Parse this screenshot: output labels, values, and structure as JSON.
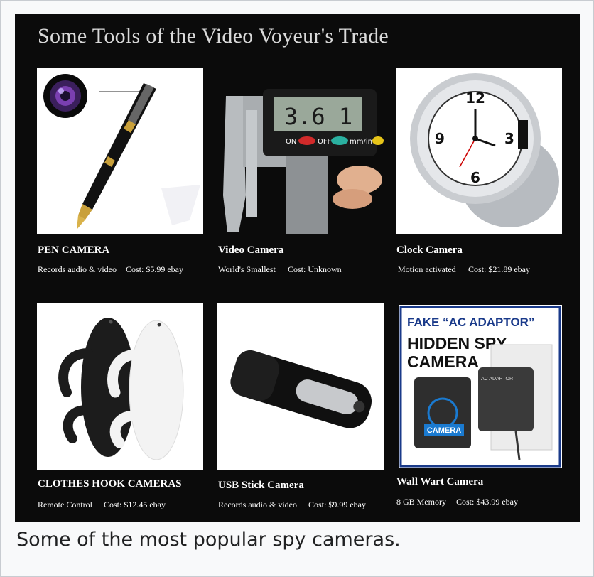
{
  "poster": {
    "title": "Some Tools of the Video Voyeur's Trade",
    "items": [
      {
        "name": "PEN CAMERA",
        "description": "Records audio & video",
        "cost": "Cost: $5.99 ebay",
        "image": "pen-camera-photo"
      },
      {
        "name": "Video Camera",
        "description": "World's Smallest",
        "cost": "Cost: Unknown",
        "image": "caliper-camera-photo",
        "display_digits": "3.6 1"
      },
      {
        "name": "Clock Camera",
        "description": "Motion activated",
        "cost": "Cost: $21.89 ebay",
        "image": "clock-camera-photo"
      },
      {
        "name": "CLOTHES HOOK CAMERAS",
        "description": "Remote Control",
        "cost": "Cost: $12.45 ebay",
        "image": "clothes-hook-camera-photo"
      },
      {
        "name": "USB Stick Camera",
        "description": "Records audio & video",
        "cost": "Cost: $9.99 ebay",
        "image": "usb-stick-camera-photo"
      },
      {
        "name": "Wall Wart Camera",
        "description": "8 GB Memory",
        "cost": "Cost: $43.99 ebay",
        "image": "wall-wart-camera-photo",
        "image_text": {
          "headline": "FAKE “AC ADAPTOR”",
          "subhead_1": "HIDDEN SPY",
          "subhead_2": "CAMERA",
          "pointer_label": "CAMERA",
          "adapter_label": "AC ADAPTOR"
        }
      }
    ]
  },
  "caption": "Some of the most popular spy cameras."
}
